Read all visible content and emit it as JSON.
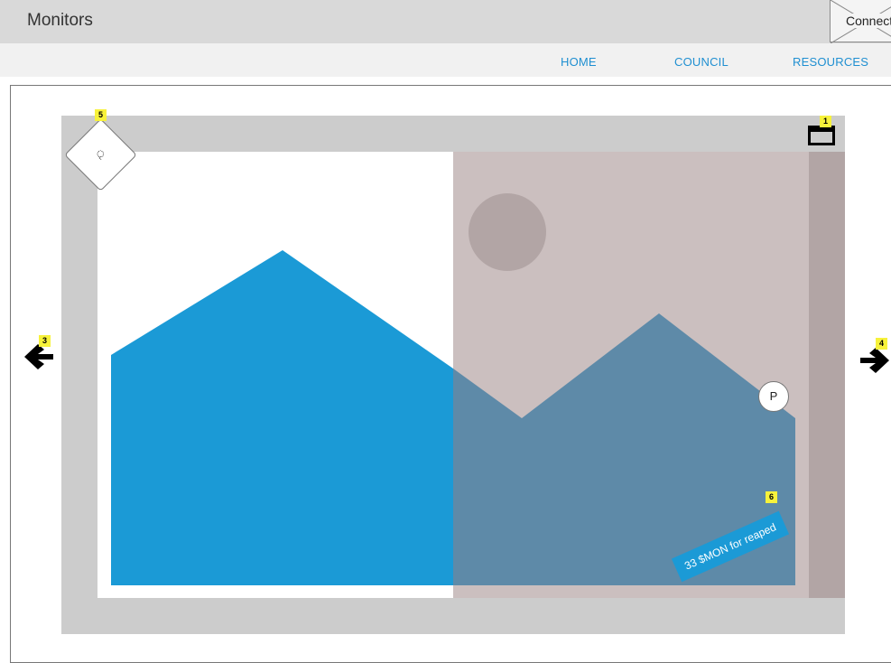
{
  "header": {
    "title": "Monitors",
    "connect_label": "Connect"
  },
  "nav": {
    "items": [
      "HOME",
      "COUNCIL",
      "RESOURCES"
    ]
  },
  "carousel": {
    "hint_label": "P",
    "caption": "33 $MON for reaped",
    "search_glyph": "ৃ"
  },
  "badges": [
    "1",
    "3",
    "4",
    "5",
    "6"
  ],
  "colors": {
    "accent": "#1b9ad6",
    "nav_link": "#1f8fd1",
    "mountain_left": "#1b9ad6",
    "mountain_right": "#5e8aa8",
    "panel_overlay": "#cbbfbf",
    "badge": "#f7f23b"
  },
  "icons": {
    "left_arrow": "arrow-left-icon",
    "right_arrow": "arrow-right-icon",
    "close": "window-close-icon",
    "image_placeholder": "placeholder-x-icon"
  }
}
